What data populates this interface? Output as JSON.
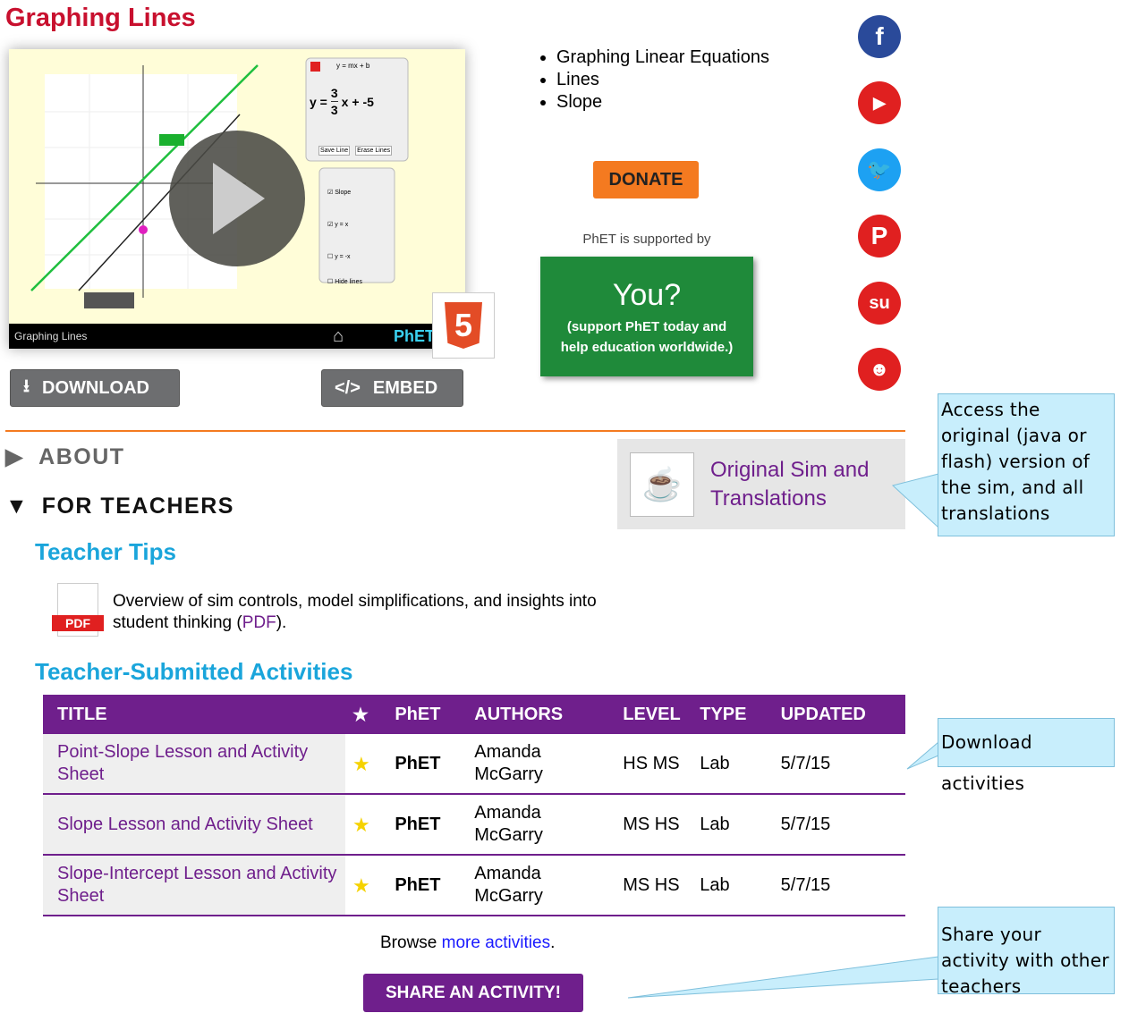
{
  "title": "Graphing Lines",
  "sim": {
    "bar_title": "Graphing Lines",
    "equation_header": "y = mx + b",
    "rise": "3",
    "run": "3",
    "intercept": "-5",
    "save_line": "Save Line",
    "erase_lines": "Erase Lines",
    "opt_slope": "Slope",
    "opt_yx": "y = x",
    "opt_ymx": "y = -x",
    "opt_hide": "Hide lines",
    "logo": "PhET",
    "html5": "5"
  },
  "download_label": "DOWNLOAD",
  "embed_label": "EMBED",
  "topics": [
    "Graphing Linear Equations",
    "Lines",
    "Slope"
  ],
  "donate_label": "DONATE",
  "supported_by": "PhET is supported by",
  "you": {
    "title": "You?",
    "text": "(support PhET today and help education worldwide.)"
  },
  "social": [
    "facebook-icon",
    "youtube-icon",
    "twitter-icon",
    "pinterest-icon",
    "stumbleupon-icon",
    "reddit-icon"
  ],
  "about": "ABOUT",
  "for_teachers": "FOR TEACHERS",
  "original_sim": "Original Sim and Translations",
  "teacher_tips": "Teacher Tips",
  "tips_text": "Overview of sim controls, model simplifications, and insights into student thinking (",
  "tips_link": "PDF",
  "tips_end": ").",
  "pdf_badge": "PDF",
  "activities_title": "Teacher-Submitted Activities",
  "table": {
    "headers": [
      "TITLE",
      "★",
      "PhET",
      "AUTHORS",
      "LEVEL",
      "TYPE",
      "UPDATED"
    ],
    "rows": [
      {
        "title": "Point-Slope Lesson and Activity Sheet",
        "phet": "PhET",
        "authors": "Amanda McGarry",
        "level": "HS MS",
        "type": "Lab",
        "updated": "5/7/15"
      },
      {
        "title": "Slope Lesson and Activity Sheet",
        "phet": "PhET",
        "authors": "Amanda McGarry",
        "level": "MS HS",
        "type": "Lab",
        "updated": "5/7/15"
      },
      {
        "title": "Slope-Intercept Lesson and Activity Sheet",
        "phet": "PhET",
        "authors": "Amanda McGarry",
        "level": "MS HS",
        "type": "Lab",
        "updated": "5/7/15"
      }
    ]
  },
  "browse_pre": "Browse ",
  "browse_link": "more activities",
  "browse_post": ".",
  "share_label": "SHARE AN ACTIVITY!",
  "callouts": [
    "Access the original (java or flash) version of the sim, and all translations",
    "Download activities",
    "Share your activity with other teachers"
  ],
  "colors": {
    "title": "#c8102e",
    "accent": "#1aa5db",
    "purple": "#6f1f8c",
    "donate": "#f47a20"
  }
}
